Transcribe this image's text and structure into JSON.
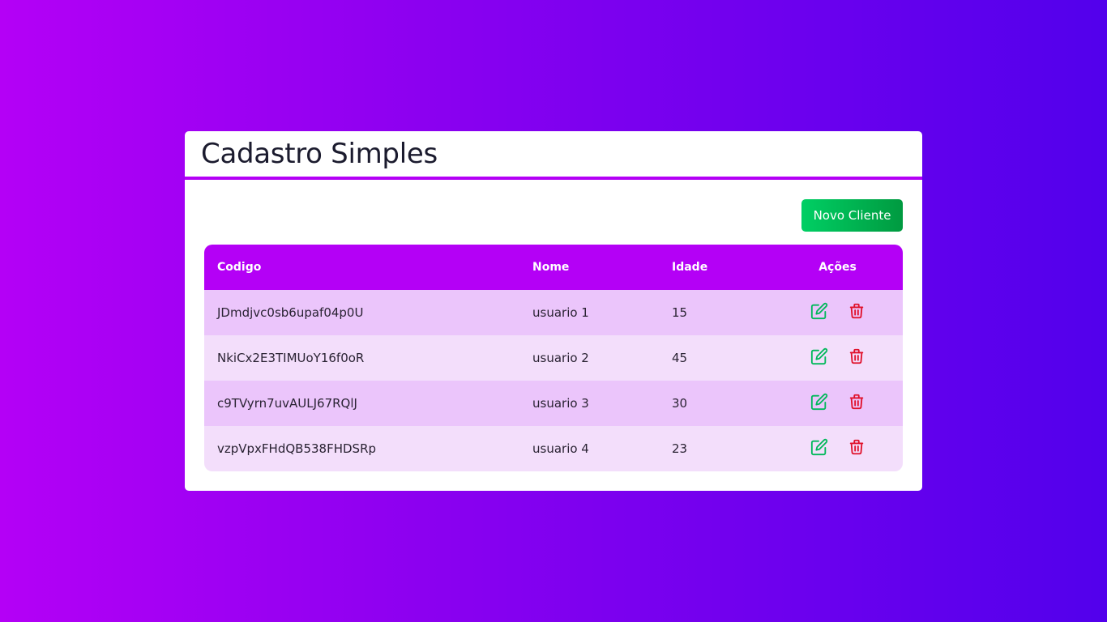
{
  "header": {
    "title": "Cadastro Simples"
  },
  "toolbar": {
    "new_label": "Novo Cliente"
  },
  "table": {
    "columns": [
      "Codigo",
      "Nome",
      "Idade",
      "Ações"
    ],
    "rows": [
      {
        "codigo": "JDmdjvc0sb6upaf04p0U",
        "nome": "usuario 1",
        "idade": "15"
      },
      {
        "codigo": "NkiCx2E3TIMUoY16f0oR",
        "nome": "usuario 2",
        "idade": "45"
      },
      {
        "codigo": "c9TVyrn7uvAULJ67RQlJ",
        "nome": "usuario 3",
        "idade": "30"
      },
      {
        "codigo": "vzpVpxFHdQB538FHDSRp",
        "nome": "usuario 4",
        "idade": "23"
      }
    ],
    "actions": {
      "edit_icon": "edit-icon",
      "delete_icon": "trash-icon"
    }
  },
  "colors": {
    "background_start": "#b400f6",
    "background_end": "#5200ec",
    "accent": "#b400f6",
    "button_green": "#00c05a",
    "edit_green": "#00b85a",
    "delete_red": "#e0112b",
    "row_odd": "#ebc5fb",
    "row_even": "#f3defb"
  }
}
